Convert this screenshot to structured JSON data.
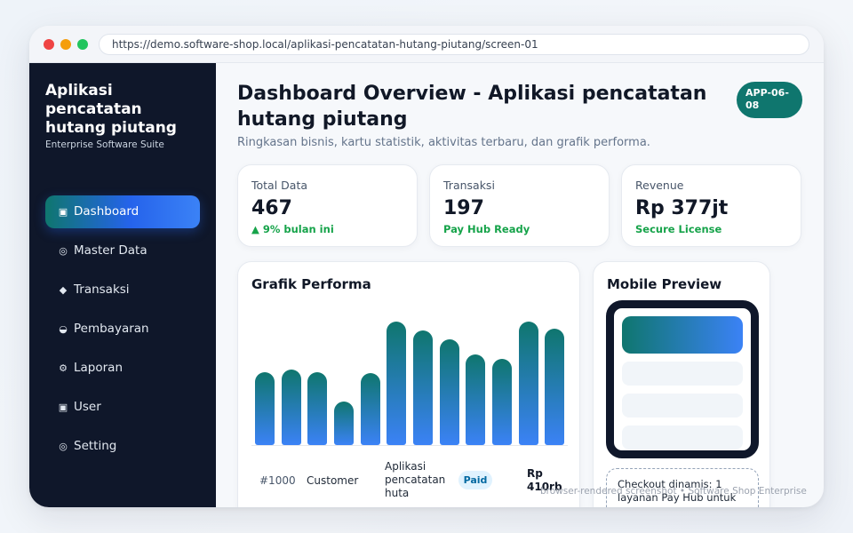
{
  "browser": {
    "url": "https://demo.software-shop.local/aplikasi-pencatatan-hutang-piutang/screen-01"
  },
  "sidebar": {
    "brand": "Aplikasi pencatatan hutang piutang",
    "tagline": "Enterprise Software Suite",
    "items": [
      {
        "label": "Dashboard",
        "icon": "▣",
        "active": true
      },
      {
        "label": "Master Data",
        "icon": "◎"
      },
      {
        "label": "Transaksi",
        "icon": "◆"
      },
      {
        "label": "Pembayaran",
        "icon": "◒"
      },
      {
        "label": "Laporan",
        "icon": "⚙"
      },
      {
        "label": "User",
        "icon": "▣"
      },
      {
        "label": "Setting",
        "icon": "◎"
      }
    ]
  },
  "header": {
    "title": "Dashboard Overview - Aplikasi pencatatan hutang piutang",
    "subtitle": "Ringkasan bisnis, kartu statistik, aktivitas terbaru, dan grafik performa.",
    "badge": "APP-06-08"
  },
  "stats": [
    {
      "label": "Total Data",
      "value": "467",
      "note": "▲ 9% bulan ini"
    },
    {
      "label": "Transaksi",
      "value": "197",
      "note": "Pay Hub Ready"
    },
    {
      "label": "Revenue",
      "value": "Rp 377jt",
      "note": "Secure License"
    }
  ],
  "chart": {
    "title": "Grafik Performa"
  },
  "chart_data": {
    "type": "bar",
    "values": [
      66,
      68,
      66,
      39,
      65,
      111,
      103,
      95,
      82,
      78,
      111,
      105
    ],
    "ylim": [
      0,
      120
    ]
  },
  "table_row": {
    "id": "#1000",
    "customer": "Customer",
    "product": "Aplikasi pencatatan huta",
    "status": "Paid",
    "amount": "Rp 410rb"
  },
  "mobile": {
    "title": "Mobile Preview",
    "note": "Checkout dinamis: 1 layanan Pay Hub untuk"
  },
  "watermark": "browser-rendered screenshot • Software Shop Enterprise",
  "colors": {
    "sidebar_bg": "#0f172a",
    "accent_teal": "#0f766e",
    "accent_blue": "#3b82f6",
    "positive": "#16a34a"
  }
}
